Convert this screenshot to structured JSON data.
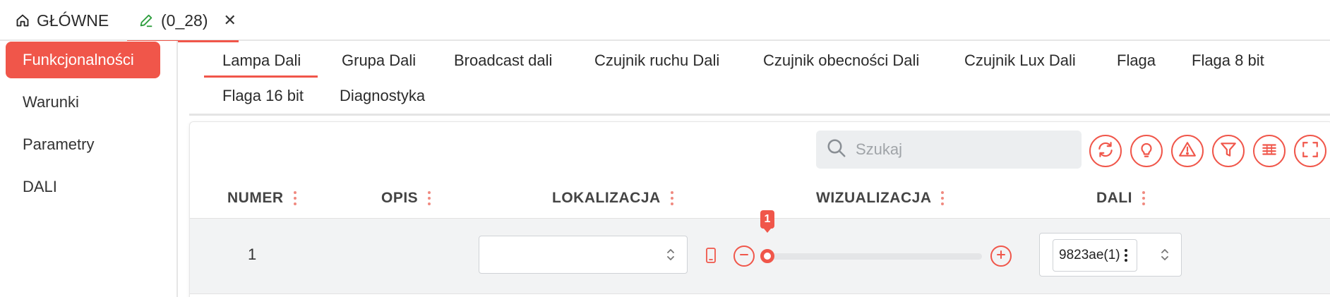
{
  "top_tabs": {
    "home_label": "GŁÓWNE",
    "doc_label": "(0_28)",
    "close_symbol": "✕"
  },
  "sidebar": {
    "items": [
      {
        "label": "Funkcjonalności",
        "active": true
      },
      {
        "label": "Warunki"
      },
      {
        "label": "Parametry"
      },
      {
        "label": "DALI"
      }
    ]
  },
  "function_tabs": [
    {
      "label": "Lampa Dali",
      "active": true
    },
    {
      "label": "Grupa Dali"
    },
    {
      "label": "Broadcast dali"
    },
    {
      "label": "Czujnik ruchu Dali"
    },
    {
      "label": "Czujnik obecności Dali"
    },
    {
      "label": "Czujnik Lux Dali"
    },
    {
      "label": "Flaga"
    },
    {
      "label": "Flaga 8 bit"
    },
    {
      "label": "Flaga 16 bit"
    },
    {
      "label": "Diagnostyka"
    }
  ],
  "search": {
    "placeholder": "Szukaj",
    "value": ""
  },
  "toolbar_icons": [
    "refresh-icon",
    "lightbulb-icon",
    "warning-icon",
    "filter-icon",
    "columns-icon",
    "fullscreen-icon"
  ],
  "table": {
    "columns": [
      "NUMER",
      "OPIS",
      "LOKALIZACJA",
      "WIZUALIZACJA",
      "DALI"
    ],
    "rows": [
      {
        "numer": "1",
        "opis": "",
        "lokalizacja": "",
        "slider_value": "1",
        "dali": "9823ae(1)"
      }
    ]
  },
  "colors": {
    "accent": "#f0564a",
    "sidebar_active_text": "#ffffff",
    "row_background": "#f2f3f4"
  }
}
